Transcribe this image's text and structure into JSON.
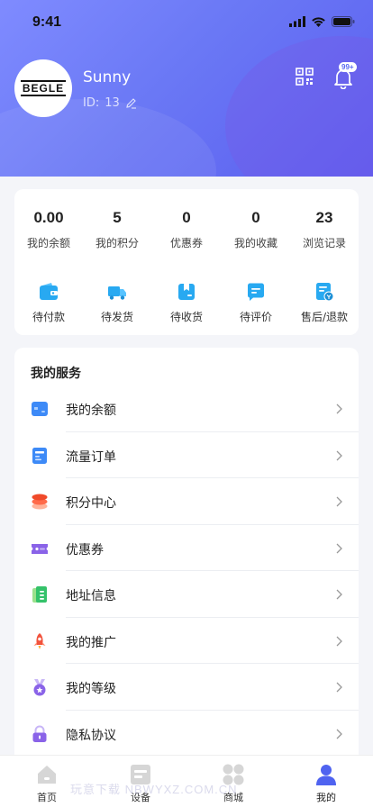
{
  "status_bar": {
    "time": "9:41"
  },
  "profile": {
    "avatar_logo_text": "BEGLE",
    "name": "Sunny",
    "id_label": "ID:",
    "id_value": "13",
    "notification_badge": "99+"
  },
  "stats": [
    {
      "value": "0.00",
      "label": "我的余额"
    },
    {
      "value": "5",
      "label": "我的积分"
    },
    {
      "value": "0",
      "label": "优惠券"
    },
    {
      "value": "0",
      "label": "我的收藏"
    },
    {
      "value": "23",
      "label": "浏览记录"
    }
  ],
  "orders": [
    {
      "label": "待付款",
      "icon": "wallet-icon"
    },
    {
      "label": "待发货",
      "icon": "truck-icon"
    },
    {
      "label": "待收货",
      "icon": "package-icon"
    },
    {
      "label": "待评价",
      "icon": "comment-icon"
    },
    {
      "label": "售后/退款",
      "icon": "refund-icon"
    }
  ],
  "services": {
    "title": "我的服务",
    "items": [
      {
        "label": "我的余额",
        "icon": "balance-card-icon"
      },
      {
        "label": "流量订单",
        "icon": "order-list-icon"
      },
      {
        "label": "积分中心",
        "icon": "coins-icon"
      },
      {
        "label": "优惠券",
        "icon": "ticket-icon"
      },
      {
        "label": "地址信息",
        "icon": "address-book-icon"
      },
      {
        "label": "我的推广",
        "icon": "rocket-icon"
      },
      {
        "label": "我的等级",
        "icon": "medal-icon"
      },
      {
        "label": "隐私协议",
        "icon": "lock-icon"
      }
    ]
  },
  "tabbar": {
    "items": [
      {
        "label": "首页",
        "icon": "home-icon"
      },
      {
        "label": "设备",
        "icon": "device-icon"
      },
      {
        "label": "商城",
        "icon": "mall-icon"
      },
      {
        "label": "我的",
        "icon": "user-icon"
      }
    ],
    "active_index": 3
  },
  "watermark": "玩意下载 NBWYXZ.COM.CN",
  "colors": {
    "accent": "#5b6cf2",
    "header_gradient_start": "#7f8bff",
    "header_gradient_end": "#5b5ef0"
  }
}
